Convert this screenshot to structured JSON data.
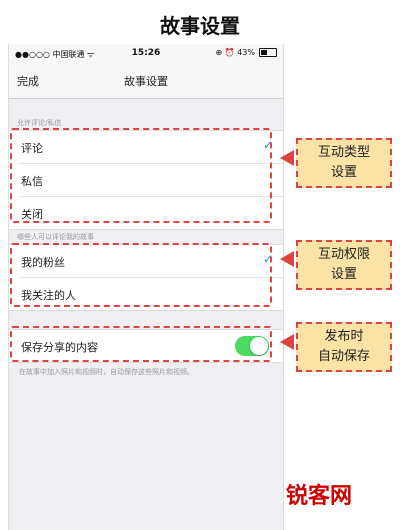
{
  "page_title": "故事设置",
  "status_bar": {
    "carrier": "●●○○○ 中国联通 ᯤ",
    "time": "15:26",
    "right": "⊕ ⏰ 43%"
  },
  "nav": {
    "done_label": "完成",
    "title": "故事设置"
  },
  "section_comments": {
    "header": "允许评论/私信",
    "items": [
      "评论",
      "私信",
      "关闭"
    ],
    "checkmark": "✓"
  },
  "section_who": {
    "header": "哪些人可以评论我的故事",
    "items": [
      "我的粉丝",
      "我关注的人"
    ],
    "checkmark": "✓"
  },
  "save_setting": {
    "label": "保存分享的内容",
    "enabled": true,
    "note": "在故事中加入照片和视频时，自动保存这些照片和视频。"
  },
  "callouts": {
    "type": "互动类型\n设置",
    "permission": "互动权限\n设置",
    "autosave": "发布时\n自动保存"
  },
  "watermark": "锐客网",
  "colors": {
    "toggle_on": "#4cd964",
    "check": "#1a8cff",
    "highlight": "#dd4444",
    "callout_bg": "#fbe3a6"
  }
}
